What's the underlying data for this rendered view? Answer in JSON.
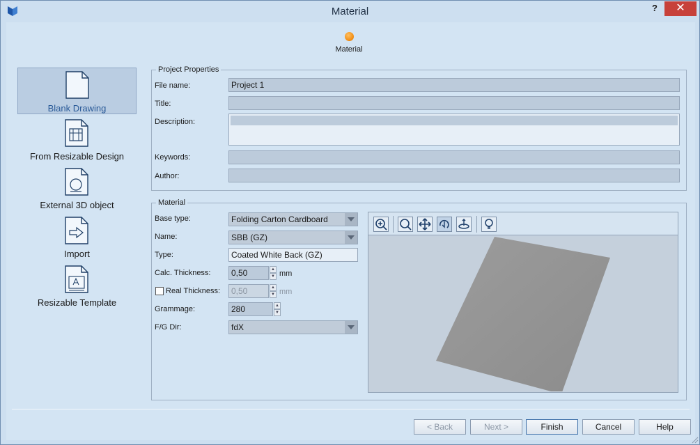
{
  "window": {
    "title": "Material",
    "help_label": "?",
    "close_label": "✕"
  },
  "step": {
    "label": "Material",
    "color": "#f08a10"
  },
  "left_nav": [
    {
      "label": "Blank Drawing",
      "icon": "blank-document-icon",
      "selected": true
    },
    {
      "label": "From Resizable Design",
      "icon": "resizable-design-icon",
      "selected": false
    },
    {
      "label": "External 3D object",
      "icon": "external-3d-icon",
      "selected": false
    },
    {
      "label": "Import",
      "icon": "import-icon",
      "selected": false
    },
    {
      "label": "Resizable Template",
      "icon": "resizable-template-icon",
      "selected": false
    }
  ],
  "project": {
    "legend": "Project Properties",
    "file_name_label": "File name:",
    "file_name": "Project 1",
    "title_label": "Title:",
    "title": "",
    "description_label": "Description:",
    "description": "",
    "keywords_label": "Keywords:",
    "keywords": "",
    "author_label": "Author:",
    "author": ""
  },
  "material": {
    "legend": "Material",
    "base_type_label": "Base type:",
    "base_type": "Folding Carton Cardboard",
    "name_label": "Name:",
    "name": "SBB (GZ)",
    "type_label": "Type:",
    "type": "Coated White Back (GZ)",
    "calc_thickness_label": "Calc. Thickness:",
    "calc_thickness": "0,50",
    "calc_thickness_unit": "mm",
    "real_thickness_label": "Real Thickness:",
    "real_thickness": "0,50",
    "real_thickness_unit": "mm",
    "real_thickness_checked": false,
    "grammage_label": "Grammage:",
    "grammage": "280",
    "fg_dir_label": "F/G Dir:",
    "fg_dir": "fdX"
  },
  "viewer_toolbar": [
    "zoom-window-icon",
    "zoom-icon",
    "pan-icon",
    "rotate-icon",
    "orbit-icon",
    "light-icon"
  ],
  "buttons": {
    "back": "< Back",
    "next": "Next >",
    "finish": "Finish",
    "cancel": "Cancel",
    "help": "Help"
  },
  "colors": {
    "accent": "#3d6fa8",
    "background": "#d3e4f3",
    "close": "#c7413a"
  }
}
